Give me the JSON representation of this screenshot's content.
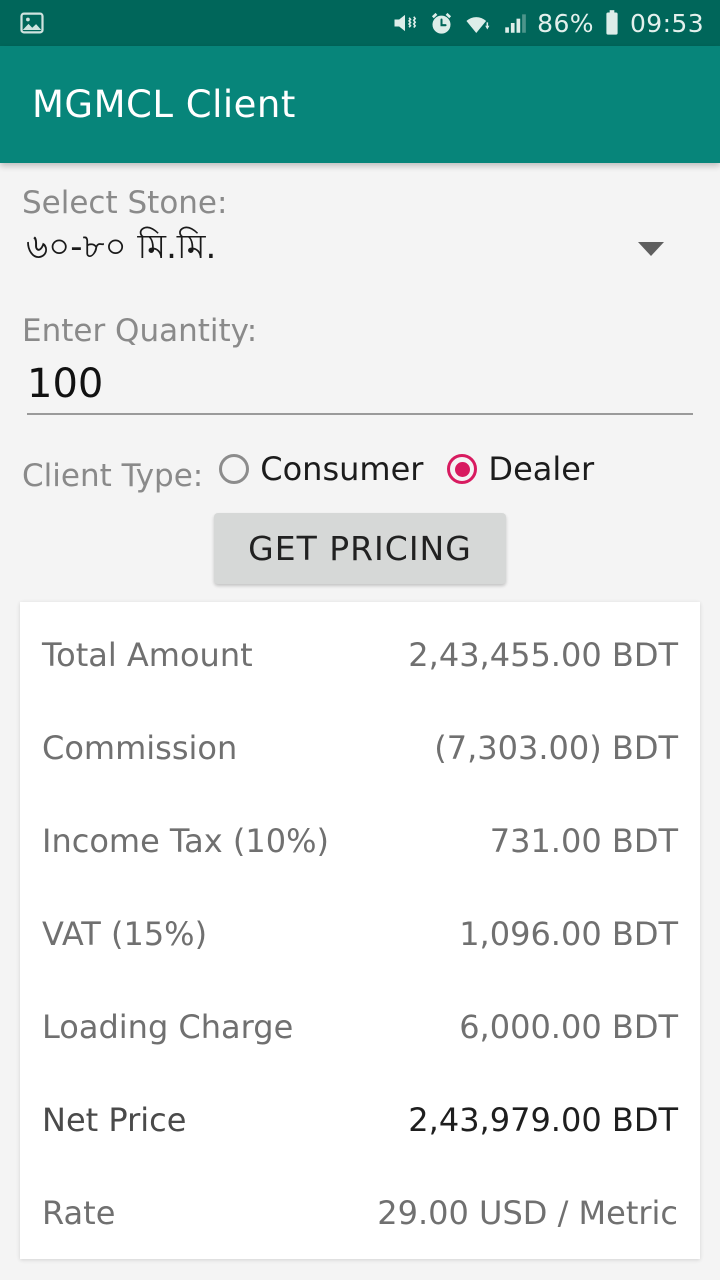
{
  "status_bar": {
    "notification_icon": "image-icon",
    "icons": [
      "mute-vibrate-icon",
      "alarm-icon",
      "wifi-icon",
      "signal-icon"
    ],
    "battery_percent": "86%",
    "battery_icon": "battery-icon",
    "time": "09:53"
  },
  "app_bar": {
    "title": "MGMCL Client",
    "background_color": "#07857A"
  },
  "form": {
    "stone": {
      "label": "Select Stone:",
      "selected_value": "৬০-৮০ মি.মি.",
      "dropdown_icon": "chevron-down-icon"
    },
    "quantity": {
      "label": "Enter Quantity:",
      "value": "100",
      "placeholder": ""
    },
    "client_type": {
      "label": "Client Type:",
      "options": [
        {
          "label": "Consumer",
          "checked": false
        },
        {
          "label": "Dealer",
          "checked": true
        }
      ],
      "selected_color": "#D81B60"
    },
    "submit_button": {
      "label": "GET PRICING"
    }
  },
  "results": {
    "rows": [
      {
        "label": "Total Amount",
        "value": "2,43,455.00 BDT"
      },
      {
        "label": "Commission",
        "value": "(7,303.00) BDT"
      },
      {
        "label": "Income Tax (10%)",
        "value": "731.00 BDT"
      },
      {
        "label": "VAT (15%)",
        "value": "1,096.00 BDT"
      },
      {
        "label": "Loading Charge",
        "value": "6,000.00 BDT"
      },
      {
        "label": "Net Price",
        "value": "2,43,979.00 BDT"
      },
      {
        "label": "Rate",
        "value": "29.00 USD / Metric"
      }
    ]
  }
}
